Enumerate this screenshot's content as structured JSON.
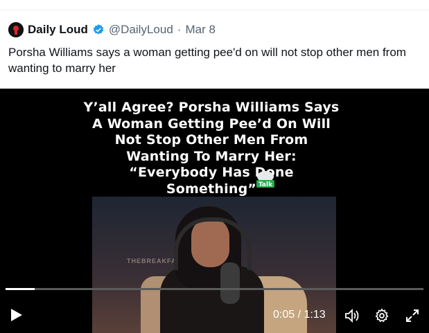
{
  "tweet": {
    "author_name": "Daily Loud",
    "handle": "@DailyLoud",
    "separator": "·",
    "date": "Mar 8",
    "text": "Porsha Williams says a woman getting pee'd on will not stop other men from wanting to marry her"
  },
  "video": {
    "headline": "Y’all Agree? Porsha Williams Says A Woman Getting Pee’d On Will Not Stop Other Men From Wanting To Marry Her: “Everybody Has Done Something”",
    "talk_logo_text": "Talk",
    "studio_text": "THEBREAKFAST",
    "time_display": "0:05 / 1:13",
    "progress": 0.07,
    "colors": {
      "progress_track": "#5b5b5b",
      "progress_fill": "#ffffff",
      "background": "#000000"
    }
  },
  "icons": {
    "avatar": "daily-loud-logo",
    "verified": "verified-badge-icon",
    "play": "play-icon",
    "volume": "volume-icon",
    "settings": "gear-icon",
    "fullscreen": "expand-icon"
  },
  "colors": {
    "verified": "#1d9bf0",
    "text": "#0f1419",
    "muted": "#536471"
  }
}
